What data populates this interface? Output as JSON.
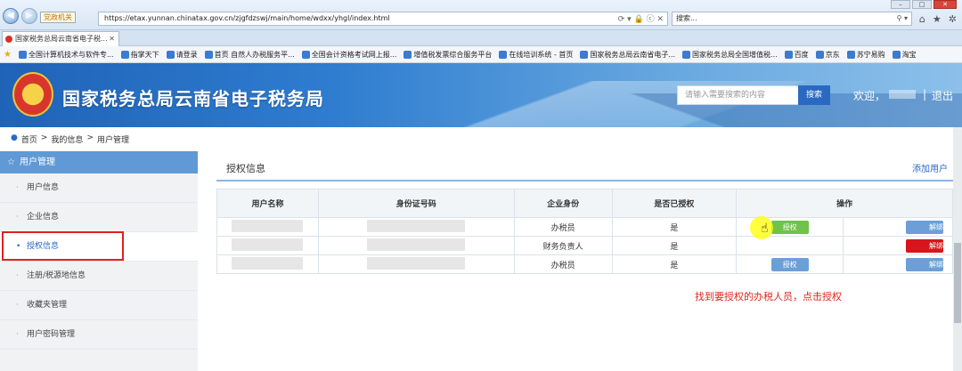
{
  "browser": {
    "net_label": "党政机关",
    "url": "https://etax.yunnan.chinatax.gov.cn/zjgfdzswj/main/home/wdxx/yhgl/index.html",
    "search_placeholder": "搜索...",
    "tab_title": "国家税务总局云南省电子税...",
    "favorites": [
      "全国计算机技术与软件专...",
      "指掌天下",
      "请登录",
      "首页 自然人办税服务平...",
      "全国会计资格考试网上报...",
      "增值税发票综合服务平台",
      "在线培训系统 - 首页",
      "国家税务总局云南省电子...",
      "国家税务总局全国增值税...",
      "百度",
      "京东",
      "苏宁易购",
      "淘宝"
    ]
  },
  "header": {
    "site_title": "国家税务总局云南省电子税务局",
    "search_placeholder": "请输入需要搜索的内容",
    "search_button": "搜索",
    "welcome": "欢迎，",
    "separator": "|",
    "logout": "退出"
  },
  "breadcrumb": [
    "首页",
    ">",
    "我的信息",
    ">",
    "用户管理"
  ],
  "sidebar": {
    "heading": "用户管理",
    "items": [
      "用户信息",
      "企业信息",
      "授权信息",
      "注册/税源地信息",
      "收藏夹管理",
      "用户密码管理"
    ]
  },
  "main": {
    "title": "授权信息",
    "add_user": "添加用户",
    "columns": [
      "用户名称",
      "身份证号码",
      "企业身份",
      "是否已授权",
      "操作"
    ],
    "rows": [
      {
        "role": "办税员",
        "authorized": "是",
        "action": "授权",
        "unbind": "解绑"
      },
      {
        "role": "财务负责人",
        "authorized": "是",
        "unbind": "解绑"
      },
      {
        "role": "办税员",
        "authorized": "是",
        "action": "授权",
        "unbind": "解绑"
      }
    ],
    "instruction": "找到要授权的办税人员，点击授权"
  },
  "colors": {
    "primary": "#2a6ac6",
    "sidebar_head": "#5f99d6",
    "highlight_red": "#e02020",
    "button_green": "#6fc24a",
    "button_red": "#d9141c"
  }
}
